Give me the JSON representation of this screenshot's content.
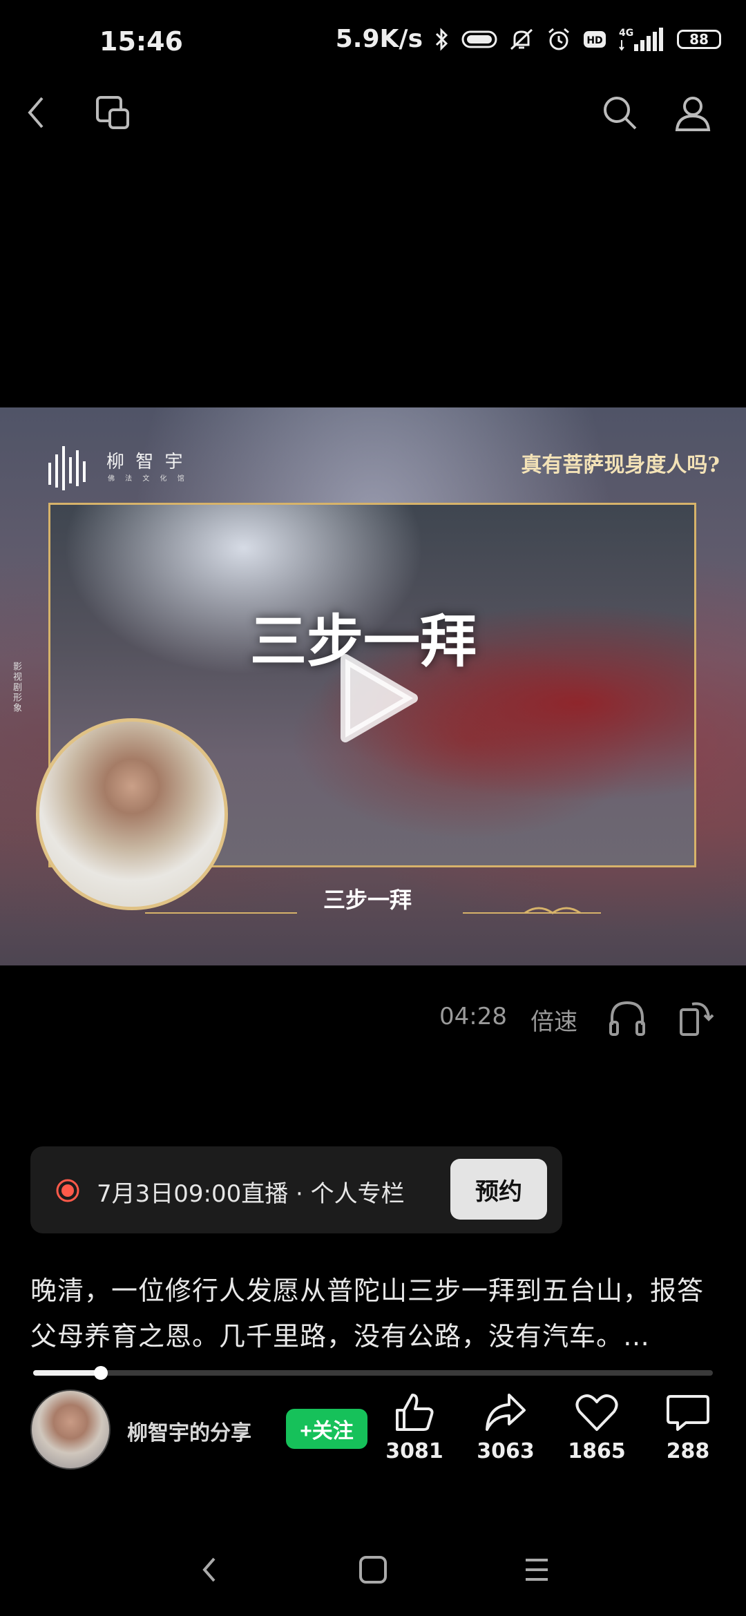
{
  "status_bar": {
    "time": "15:46",
    "net_speed": "5.9K/s",
    "network": "4G",
    "battery": "88",
    "icons": [
      "bluetooth-icon",
      "toggle-icon",
      "mute-icon",
      "alarm-icon",
      "hd-icon",
      "signal-icon"
    ]
  },
  "top_nav": {
    "icons": [
      "back-icon",
      "window-icon",
      "search-icon",
      "profile-icon"
    ]
  },
  "video": {
    "logo_text": "柳 智 宇",
    "logo_sub": "佛 法 文 化 馆",
    "question": "真有菩萨现身度人吗?",
    "side_text": "影视剧形象",
    "title": "三步一拜",
    "subtitle": "三步一拜"
  },
  "controls": {
    "duration": "04:28",
    "speed_label": "倍速",
    "icons": [
      "headphones-icon",
      "rotate-icon"
    ]
  },
  "live": {
    "text": "7月3日09:00直播 · 个人专栏",
    "button": "预约"
  },
  "description": {
    "line1": "晚清，一位修行人发愿从普陀山三步一拜到五台山，报答",
    "line2": "父母养育之恩。几千里路，没有公路，没有汽车。…"
  },
  "progress": {
    "fraction": 0.1
  },
  "author": {
    "name": "柳智宇的分享",
    "follow_label": "+关注"
  },
  "actions": {
    "like_count": "3081",
    "share_count": "3063",
    "favorite_count": "1865",
    "comment_count": "288"
  },
  "colors": {
    "accent_green": "#16c15a",
    "live_red": "#ff5a4a",
    "gold": "#d7b36a"
  }
}
